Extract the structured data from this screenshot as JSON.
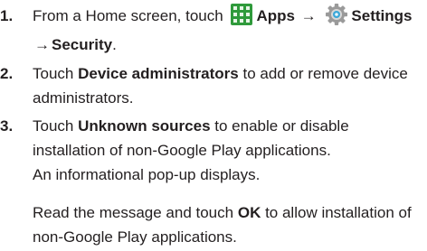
{
  "steps": [
    {
      "number": "1.",
      "line1_prefix": "From a Home screen, touch",
      "apps_label": "Apps",
      "arrow1": "→",
      "settings_label": "Settings",
      "arrow2": "→",
      "security_label": "Security",
      "end_punct": ".",
      "apps_icon": "apps-grid-icon",
      "settings_icon": "settings-gear-icon"
    },
    {
      "number": "2.",
      "prefix": "Touch",
      "bold": "Device administrators",
      "suffix": "to add or remove device",
      "line2": "administrators."
    },
    {
      "number": "3.",
      "prefix": "Touch",
      "bold": "Unknown sources",
      "suffix": "to enable or disable",
      "line2": "installation of non-Google Play applications.",
      "line3": "An informational pop-up displays.",
      "para2_prefix": "Read the message and touch",
      "para2_bold": "OK",
      "para2_suffix": "to allow installation of",
      "para2_line2": "non-Google Play applications."
    }
  ],
  "colors": {
    "text": "#231f20",
    "apps_icon": "#2f9a3b",
    "settings_icon": "#7a7a7a"
  }
}
